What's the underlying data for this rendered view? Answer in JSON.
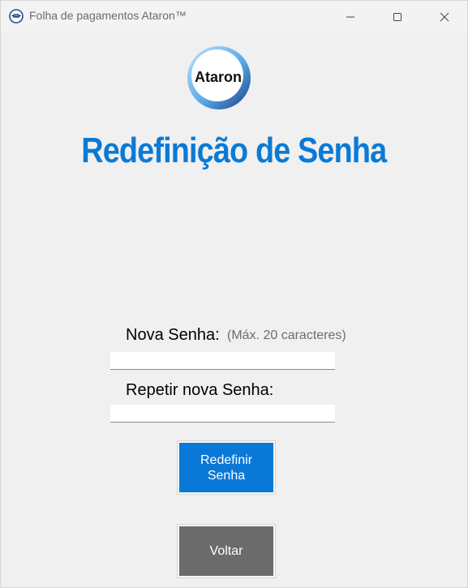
{
  "window": {
    "title": "Folha de pagamentos Ataron™",
    "controls": [
      "minimize-icon",
      "maximize-icon",
      "close-icon"
    ]
  },
  "logo": {
    "text": "Ataron"
  },
  "page": {
    "title": "Redefinição de Senha"
  },
  "form": {
    "new_password_label": "Nova Senha:",
    "new_password_hint": "(Máx. 20 caracteres)",
    "new_password_value": "",
    "repeat_password_label": "Repetir nova Senha:",
    "repeat_password_value": ""
  },
  "buttons": {
    "reset_line1": "Redefinir",
    "reset_line2": "Senha",
    "back": "Voltar"
  },
  "colors": {
    "accent": "#0a78d7",
    "title": "#0a7ad6",
    "back_button": "#6b6b6b",
    "background": "#f0f0f0"
  }
}
